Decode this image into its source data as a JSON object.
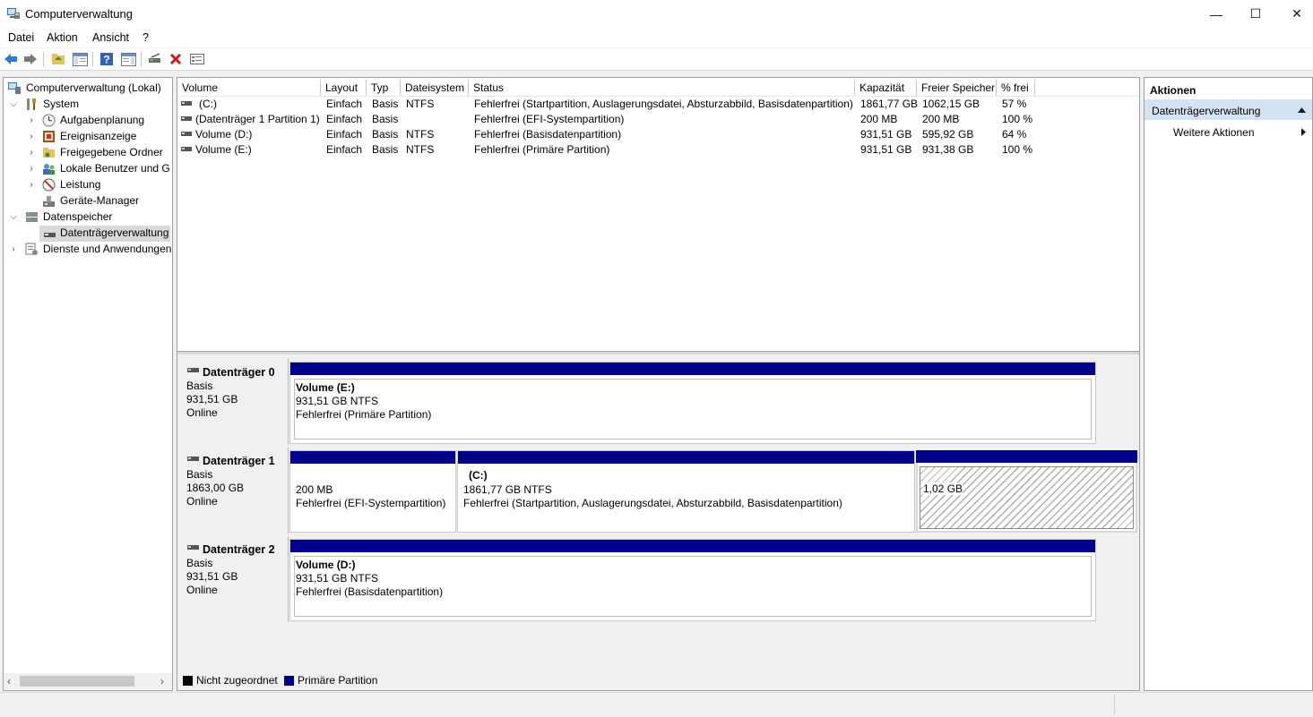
{
  "window": {
    "title": "Computerverwaltung",
    "minimize_glyph": "—",
    "maximize_glyph": "☐",
    "close_glyph": "✕"
  },
  "menu": [
    "Datei",
    "Aktion",
    "Ansicht",
    "?"
  ],
  "toolbar": {
    "icons": [
      "back-icon",
      "forward-icon",
      "folder-up-icon",
      "show-hide-console-tree-icon",
      "help-icon",
      "show-hide-action-pane-icon",
      "connect-drive-icon",
      "delete-icon",
      "properties-icon"
    ]
  },
  "tree": {
    "root": "Computerverwaltung (Lokal)",
    "system": "System",
    "items_system": [
      "Aufgabenplanung",
      "Ereignisanzeige",
      "Freigegebene Ordner",
      "Lokale Benutzer und Gr",
      "Leistung",
      "Geräte-Manager"
    ],
    "storage": "Datenspeicher",
    "disk_mgmt": "Datenträgerverwaltung",
    "services": "Dienste und Anwendungen"
  },
  "volume_list": {
    "columns": [
      "Volume",
      "Layout",
      "Typ",
      "Dateisystem",
      "Status",
      "Kapazität",
      "Freier Speicher",
      "% frei"
    ],
    "rows": [
      [
        "(C:)",
        "Einfach",
        "Basis",
        "NTFS",
        "Fehlerfrei (Startpartition, Auslagerungsdatei, Absturzabbild, Basisdatenpartition)",
        "1861,77 GB",
        "1062,15 GB",
        "57 %"
      ],
      [
        "(Datenträger 1 Partition 1)",
        "Einfach",
        "Basis",
        "",
        "Fehlerfrei (EFI-Systempartition)",
        "200 MB",
        "200 MB",
        "100 %"
      ],
      [
        "Volume (D:)",
        "Einfach",
        "Basis",
        "NTFS",
        "Fehlerfrei (Basisdatenpartition)",
        "931,51 GB",
        "595,92 GB",
        "64 %"
      ],
      [
        "Volume (E:)",
        "Einfach",
        "Basis",
        "NTFS",
        "Fehlerfrei (Primäre Partition)",
        "931,51 GB",
        "931,38 GB",
        "100 %"
      ]
    ]
  },
  "disks": [
    {
      "name": "Datenträger 0",
      "type": "Basis",
      "size": "931,51 GB",
      "state": "Online",
      "partitions": [
        {
          "title": "Volume  (E:)",
          "line1": "931,51 GB NTFS",
          "line2": "Fehlerfrei (Primäre Partition)"
        }
      ]
    },
    {
      "name": "Datenträger 1",
      "type": "Basis",
      "size": "1863,00 GB",
      "state": "Online",
      "partitions": [
        {
          "title": "",
          "line1": "200 MB",
          "line2": "Fehlerfrei (EFI-Systempartition)"
        },
        {
          "title": "(C:)",
          "line1": "1861,77 GB NTFS",
          "line2": "Fehlerfrei (Startpartition, Auslagerungsdatei, Absturzabbild, Basisdatenpartition)"
        },
        {
          "title": "",
          "line1": "1,02 GB",
          "line2": ""
        }
      ]
    },
    {
      "name": "Datenträger 2",
      "type": "Basis",
      "size": "931,51 GB",
      "state": "Online",
      "partitions": [
        {
          "title": "Volume  (D:)",
          "line1": "931,51 GB NTFS",
          "line2": "Fehlerfrei (Basisdatenpartition)"
        }
      ]
    }
  ],
  "legend": [
    {
      "label": "Nicht zugeordnet",
      "color": "#000000"
    },
    {
      "label": "Primäre Partition",
      "color": "#00008b"
    }
  ],
  "actions": {
    "header": "Aktionen",
    "section": "Datenträgerverwaltung",
    "more": "Weitere Aktionen"
  },
  "colors": {
    "primary_partition": "#00008b",
    "selection": "#cce8ff",
    "section_header": "#d4e3f3"
  }
}
